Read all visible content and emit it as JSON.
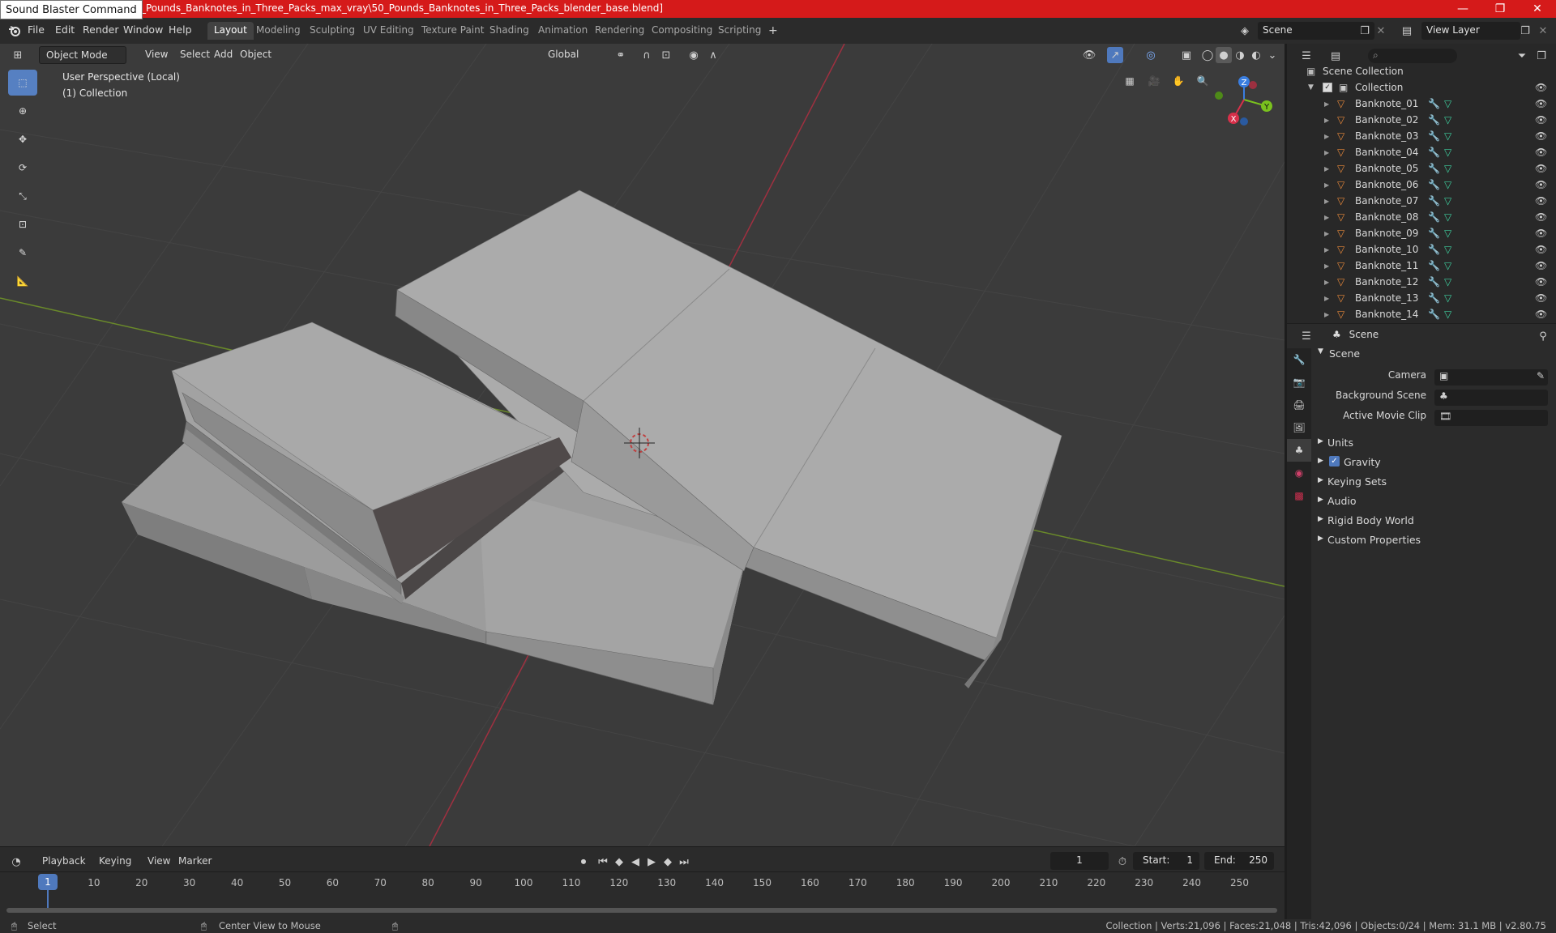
{
  "window": {
    "tooltip": "Sound Blaster Command",
    "title": "1\\50_Pounds_Banknotes_in_Three_Packs_max_vray\\50_Pounds_Banknotes_in_Three_Packs_blender_base.blend]",
    "controls": [
      "—",
      "❐",
      "✕"
    ]
  },
  "menu": {
    "items": [
      "File",
      "Edit",
      "Render",
      "Window",
      "Help"
    ],
    "workspaces": [
      "Layout",
      "Modeling",
      "Sculpting",
      "UV Editing",
      "Texture Paint",
      "Shading",
      "Animation",
      "Rendering",
      "Compositing",
      "Scripting"
    ],
    "active_workspace": "Layout",
    "add_tab": "+",
    "scene_value": "Scene",
    "view_layer_value": "View Layer"
  },
  "viewport_header": {
    "mode": "Object Mode",
    "menus": [
      "View",
      "Select",
      "Add",
      "Object"
    ],
    "orientation": "Global"
  },
  "viewport_info": {
    "perspective": "User Perspective (Local)",
    "collection": "(1) Collection"
  },
  "gizmo": {
    "x": "X",
    "y": "Y",
    "z": "Z"
  },
  "outliner": {
    "root": "Scene Collection",
    "collection": "Collection",
    "objects": [
      "Banknote_01",
      "Banknote_02",
      "Banknote_03",
      "Banknote_04",
      "Banknote_05",
      "Banknote_06",
      "Banknote_07",
      "Banknote_08",
      "Banknote_09",
      "Banknote_10",
      "Banknote_11",
      "Banknote_12",
      "Banknote_13",
      "Banknote_14"
    ]
  },
  "properties": {
    "context": "Scene",
    "section": "Scene",
    "camera_label": "Camera",
    "background_scene_label": "Background Scene",
    "active_clip_label": "Active Movie Clip",
    "panels": [
      "Units",
      "Gravity",
      "Keying Sets",
      "Audio",
      "Rigid Body World",
      "Custom Properties"
    ],
    "gravity_checked": true
  },
  "timeline": {
    "menus": [
      "Playback",
      "Keying",
      "View",
      "Marker"
    ],
    "current_frame": "1",
    "start_label": "Start:",
    "start_value": "1",
    "end_label": "End:",
    "end_value": "250",
    "ticks": [
      "10",
      "20",
      "30",
      "40",
      "50",
      "60",
      "70",
      "80",
      "90",
      "100",
      "110",
      "120",
      "130",
      "140",
      "150",
      "160",
      "170",
      "180",
      "190",
      "200",
      "210",
      "220",
      "230",
      "240",
      "250"
    ],
    "cursor_label": "1"
  },
  "statusbar": {
    "select": "Select",
    "center_view": "Center View to Mouse",
    "stats": "Collection | Verts:21,096 | Faces:21,048 | Tris:42,096 | Objects:0/24 | Mem: 31.1 MB | v2.80.75"
  },
  "colors": {
    "titlebar": "#d51a1a",
    "accent": "#5680c2",
    "object_icon": "#e8883a",
    "mesh_icon": "#3fd0a0",
    "modifier_icon": "#7fa8e8",
    "x_axis": "#d8304a",
    "y_axis": "#7ac21e",
    "z_axis": "#3a7ee0"
  }
}
